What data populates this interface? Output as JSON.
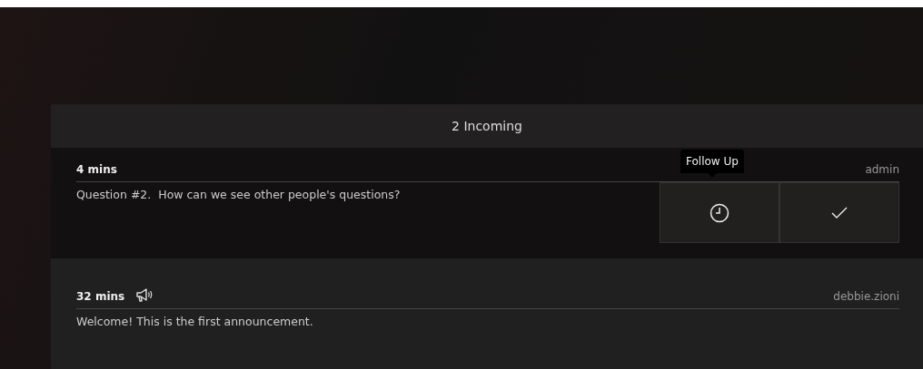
{
  "header": {
    "title": "2 Incoming"
  },
  "items": [
    {
      "kind": "question",
      "time": "4 mins",
      "author": "admin",
      "text": "Question #2.  How can we see other people's questions?",
      "actions": [
        {
          "kind": "follow-up",
          "tooltip": "Follow Up"
        },
        {
          "kind": "done"
        }
      ]
    },
    {
      "kind": "announcement",
      "time": "32 mins",
      "author": "debbie.zioni",
      "text": "Welcome! This is the first announcement."
    }
  ]
}
